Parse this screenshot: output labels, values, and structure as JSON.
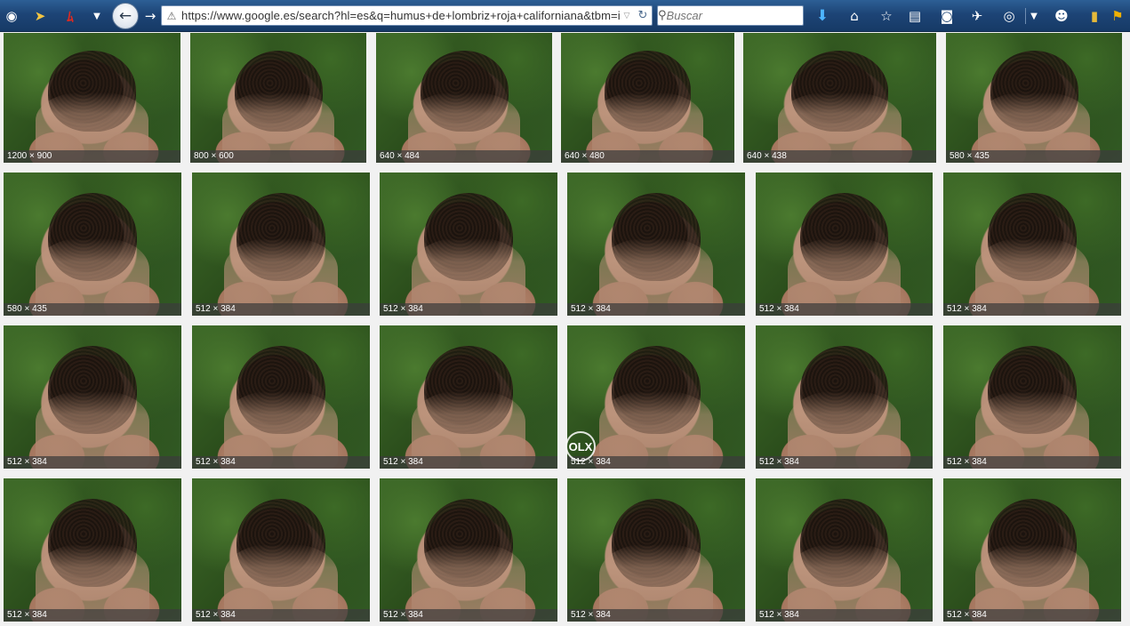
{
  "browser": {
    "url": "https://www.google.es/search?hl=es&q=humus+de+lombriz+roja+californiana&tbm=isch",
    "search_placeholder": "Buscar"
  },
  "toolbar_icons": [
    "app-menu-icon",
    "pointer-icon",
    "acrobat-icon",
    "back-icon",
    "forward-icon",
    "download-icon",
    "home-icon",
    "bookmark-star-icon",
    "reader-icon",
    "pocket-icon",
    "send-icon",
    "eye-icon",
    "smiley-icon",
    "bookmark-icon",
    "flag-icon"
  ],
  "images": [
    {
      "size": "1200 × 900"
    },
    {
      "size": "800 × 600"
    },
    {
      "size": "640 × 484"
    },
    {
      "size": "640 × 480"
    },
    {
      "size": "640 × 438"
    },
    {
      "size": "580 × 435"
    },
    {
      "size": "580 × 435"
    },
    {
      "size": "512 × 384"
    },
    {
      "size": "512 × 384"
    },
    {
      "size": "512 × 384"
    },
    {
      "size": "512 × 384"
    },
    {
      "size": "512 × 384"
    },
    {
      "size": "512 × 384"
    },
    {
      "size": "512 × 384"
    },
    {
      "size": "512 × 384"
    },
    {
      "size": "512 × 384"
    },
    {
      "size": "512 × 384"
    },
    {
      "size": "512 × 384"
    },
    {
      "size": "512 × 384"
    },
    {
      "size": "512 × 384"
    },
    {
      "size": "512 × 384"
    },
    {
      "size": "512 × 384"
    },
    {
      "size": "512 × 384"
    },
    {
      "size": "512 × 384"
    }
  ],
  "olx_badge": "OLX"
}
